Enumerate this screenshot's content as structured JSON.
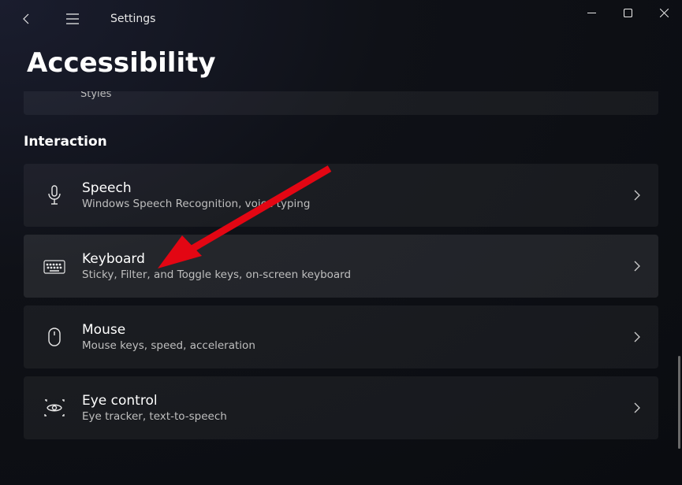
{
  "app_title": "Settings",
  "page_title": "Accessibility",
  "partial_card_subtitle": "Styles",
  "section_heading": "Interaction",
  "items": [
    {
      "title": "Speech",
      "subtitle": "Windows Speech Recognition, voice typing",
      "icon": "microphone-icon"
    },
    {
      "title": "Keyboard",
      "subtitle": "Sticky, Filter, and Toggle keys, on-screen keyboard",
      "icon": "keyboard-icon"
    },
    {
      "title": "Mouse",
      "subtitle": "Mouse keys, speed, acceleration",
      "icon": "mouse-icon"
    },
    {
      "title": "Eye control",
      "subtitle": "Eye tracker, text-to-speech",
      "icon": "eye-control-icon"
    }
  ],
  "annotation": {
    "type": "arrow",
    "target": "Keyboard",
    "color": "#e30613"
  }
}
